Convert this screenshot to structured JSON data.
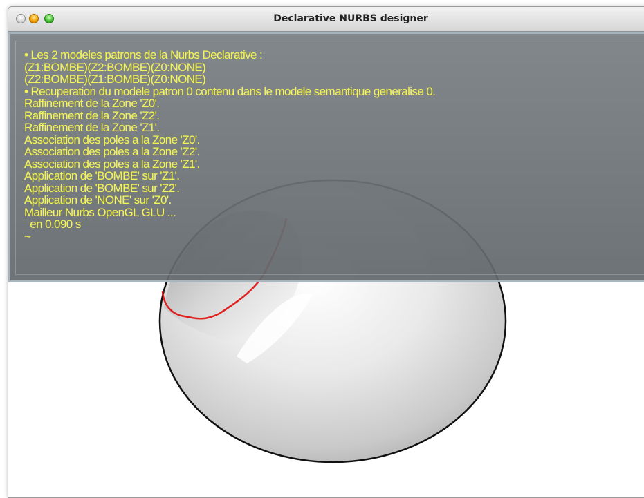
{
  "window": {
    "title": "Declarative NURBS designer"
  },
  "console": {
    "lines": [
      "• Les 2 modeles patrons de la Nurbs Declarative :",
      "(Z1:BOMBE)(Z2:BOMBE)(Z0:NONE)",
      "(Z2:BOMBE)(Z1:BOMBE)(Z0:NONE)",
      "• Recuperation du modele patron 0 contenu dans le modele semantique generalise 0.",
      "Raffinement de la Zone 'Z0'.",
      "Raffinement de la Zone 'Z2'.",
      "Raffinement de la Zone 'Z1'.",
      "Association des poles a la Zone 'Z0'.",
      "Association des poles a la Zone 'Z2'.",
      "Association des poles a la Zone 'Z1'.",
      "Application de 'BOMBE' sur 'Z1'.",
      "Application de 'BOMBE' sur 'Z2'.",
      "Application de 'NONE' sur 'Z0'.",
      "Mailleur Nurbs OpenGL GLU ...",
      "  en 0.090 s",
      "~"
    ]
  },
  "colors": {
    "console_text": "#f2f25a",
    "surface_outline": "#111111",
    "zone_curve": "#e02020"
  }
}
